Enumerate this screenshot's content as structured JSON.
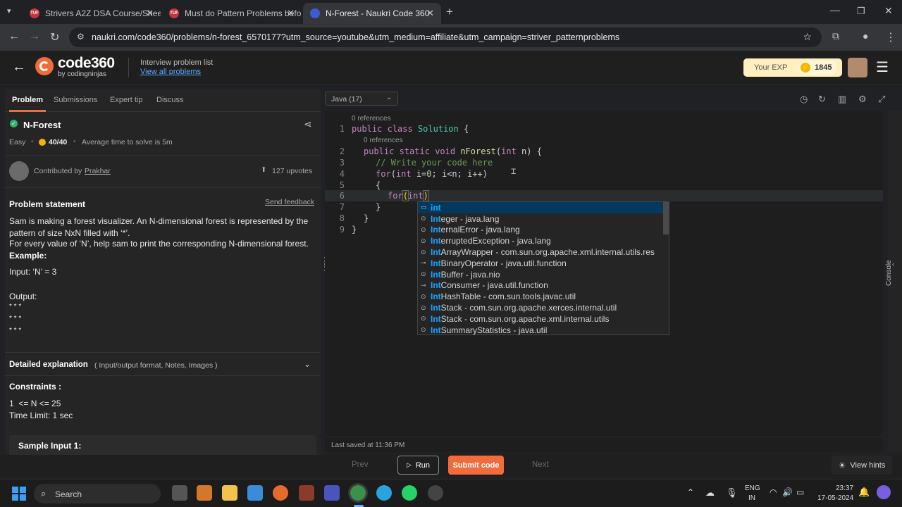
{
  "browser": {
    "tabs": [
      {
        "title": "Strivers A2Z DSA Course/Sheet",
        "icon": "tuf-icon"
      },
      {
        "title": "Must do Pattern Problems befo",
        "icon": "tuf-icon"
      },
      {
        "title": "N-Forest - Naukri Code 360",
        "icon": "code360-icon"
      }
    ],
    "url": "naukri.com/code360/problems/n-forest_6570177?utm_source=youtube&utm_medium=affiliate&utm_campaign=striver_patternproblems"
  },
  "appbar": {
    "logo_main": "code360",
    "logo_sub": "by codingninjas",
    "list_label": "Interview problem list",
    "list_link": "View all problems",
    "exp_label": "Your EXP",
    "exp_value": "1845"
  },
  "panel_tabs": [
    "Problem",
    "Submissions",
    "Expert tip",
    "Discuss"
  ],
  "problem": {
    "title": "N-Forest",
    "difficulty": "Easy",
    "score": "40/40",
    "avg_time": "Average time to solve is 5m",
    "contributed_label": "Contributed by",
    "contributor": "Prakhar",
    "upvotes": "127 upvotes",
    "statement_heading": "Problem statement",
    "feedback": "Send feedback",
    "statement_line1": "Sam is making a forest visualizer. An N-dimensional forest is represented by the pattern of size NxN filled with ‘*’.",
    "statement_line2": "For every value of ‘N’, help sam to print the corresponding N-dimensional forest.",
    "example_heading": "Example:",
    "input": "Input: ‘N’ = 3",
    "output_label": "Output:",
    "output_rows": [
      "* * *",
      "* * *",
      "* * *"
    ],
    "detailed": "Detailed explanation",
    "detailed_sub": "( Input/output format, Notes, Images )",
    "constraints_heading": "Constraints :",
    "constraint1": "1  <= N <= 25",
    "constraint2": "Time Limit: 1 sec",
    "sample_input": "Sample Input 1:"
  },
  "editor": {
    "language": "Java (17)",
    "references": "0 references",
    "line_numbers": [
      "1",
      "2",
      "3",
      "4",
      "5",
      "6",
      "7",
      "8",
      "9"
    ],
    "last_saved": "Last saved at 11:36 PM",
    "console": "Console"
  },
  "code_lines": {
    "l1": [
      "public",
      " ",
      "class",
      " ",
      "Solution",
      " {"
    ],
    "l2": [
      "public",
      " ",
      "static",
      " ",
      "void",
      " ",
      "nForest",
      "(",
      "int",
      " n) {"
    ],
    "l3": "// Write your code here",
    "l4": [
      "for",
      "(",
      "int",
      " i=",
      "0",
      "; i<n; i++)"
    ],
    "l5": "{",
    "l6": [
      "for",
      "(",
      "int",
      ")"
    ],
    "l7": "}",
    "l8": "}",
    "l9": "}"
  },
  "suggestions": [
    {
      "match": "int",
      "rest": "",
      "kind": "keyword"
    },
    {
      "match": "Int",
      "rest": "eger - java.lang",
      "kind": "class"
    },
    {
      "match": "Int",
      "rest": "ernalError - java.lang",
      "kind": "class"
    },
    {
      "match": "Int",
      "rest": "erruptedException - java.lang",
      "kind": "class"
    },
    {
      "match": "Int",
      "rest": "ArrayWrapper - com.sun.org.apache.xml.internal.utils.res",
      "kind": "class"
    },
    {
      "match": "Int",
      "rest": "BinaryOperator - java.util.function",
      "kind": "interface"
    },
    {
      "match": "Int",
      "rest": "Buffer - java.nio",
      "kind": "class"
    },
    {
      "match": "Int",
      "rest": "Consumer - java.util.function",
      "kind": "interface"
    },
    {
      "match": "Int",
      "rest": "HashTable - com.sun.tools.javac.util",
      "kind": "class"
    },
    {
      "match": "Int",
      "rest": "Stack - com.sun.org.apache.xerces.internal.util",
      "kind": "class"
    },
    {
      "match": "Int",
      "rest": "Stack - com.sun.org.apache.xml.internal.utils",
      "kind": "class"
    },
    {
      "match": "Int",
      "rest": "SummaryStatistics - java.util",
      "kind": "class"
    }
  ],
  "bottom": {
    "prev": "Prev",
    "run": "Run",
    "submit": "Submit code",
    "next": "Next",
    "hints": "View hints"
  },
  "taskbar": {
    "search": "Search",
    "lang1": "ENG",
    "lang2": "IN",
    "time": "23:37",
    "date": "17-05-2024"
  },
  "colors": {
    "accent_orange": "#f26b3a",
    "exp_bg": "#ffeebf",
    "link_blue": "#5aa9ff"
  }
}
